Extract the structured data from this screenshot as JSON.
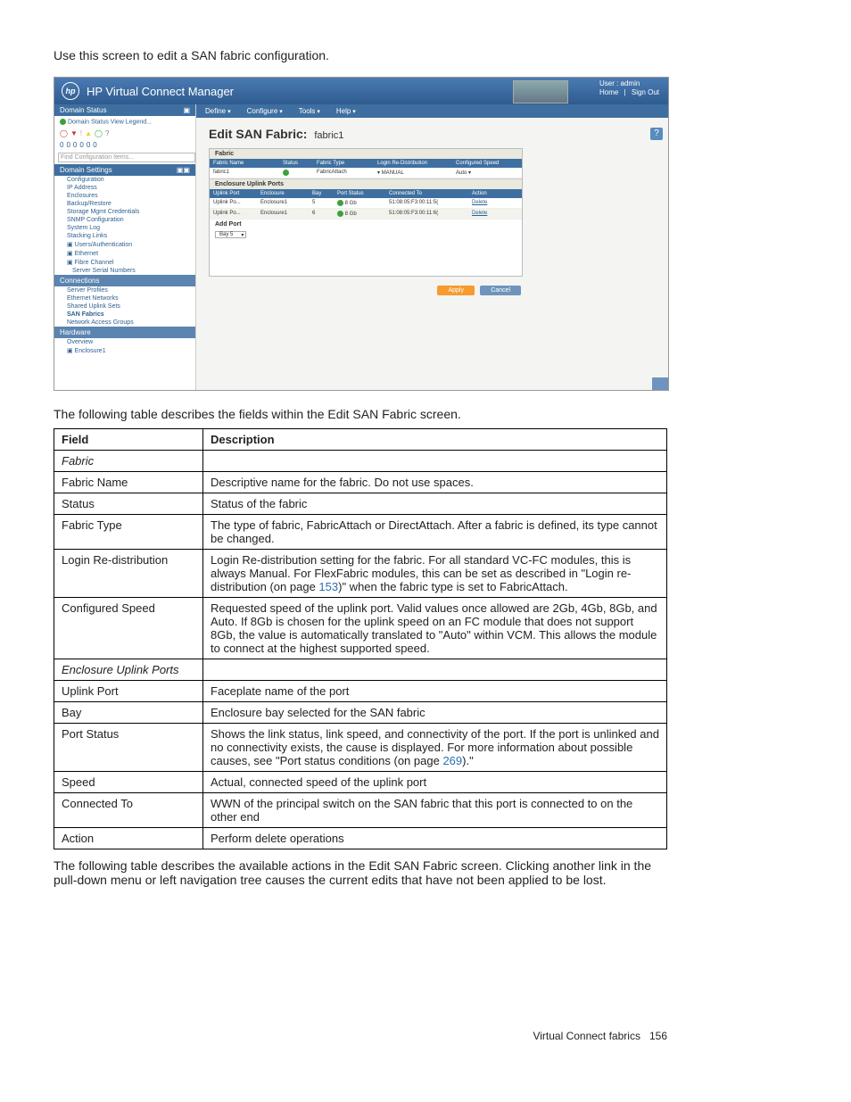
{
  "intro": "Use this screen to edit a SAN fabric configuration.",
  "shot": {
    "header_title": "HP Virtual Connect Manager",
    "logo": "hp",
    "user_line1": "User : admin",
    "home": "Home",
    "signout": "Sign Out",
    "menus": [
      "Define",
      "Configure",
      "Tools",
      "Help"
    ],
    "sidebar": {
      "status_head": "Domain Status",
      "status_sub": "Domain Status   View Legend...",
      "icons_row1": [
        "●",
        "▼",
        "!",
        "⚠",
        "○",
        "?"
      ],
      "icons_row2": [
        "0",
        "0",
        "0",
        "0",
        "0",
        "0"
      ],
      "find_placeholder": "Find Configuration Items...",
      "settings_head": "Domain Settings",
      "items": [
        "Configuration",
        "IP Address",
        "Enclosures",
        "Backup/Restore",
        "Storage Mgmt Credentials",
        "SNMP Configuration",
        "System Log",
        "Stacking Links"
      ],
      "auth_head": "Users/Authentication",
      "eth_head": "Ethernet",
      "fc_head": "Fibre Channel",
      "serial": "Server Serial Numbers",
      "conn_head": "Connections",
      "conn_items": [
        "Server Profiles",
        "Ethernet Networks",
        "Shared Uplink Sets",
        "SAN Fabrics",
        "Network Access Groups"
      ],
      "hw_head": "Hardware",
      "hw_items": [
        "Overview",
        "Enclosure1"
      ]
    },
    "content": {
      "title": "Edit SAN Fabric:",
      "title_sub": "fabric1",
      "panel_title": "Fabric",
      "cols": [
        "Fabric Name",
        "Status",
        "Fabric Type",
        "Login Re-Distribution",
        "Configured Speed"
      ],
      "row": {
        "name": "fabric1",
        "type": "FabricAttach",
        "login": "MANUAL",
        "speed": "Auto"
      },
      "uplinks_title": "Enclosure Uplink Ports",
      "uplinks_cols": [
        "Uplink Port",
        "Enclosure",
        "Bay",
        "Port Status",
        "Connected To",
        "Action"
      ],
      "uplinks_rows": [
        {
          "port": "Uplink Po...",
          "enc": "Enclosure1",
          "bay": "5",
          "speed": "8 Gb",
          "conn": "51:08:05:F3:00:11:5(",
          "action": "Delete"
        },
        {
          "port": "Uplink Po...",
          "enc": "Enclosure1",
          "bay": "6",
          "speed": "8 Gb",
          "conn": "51:08:05:F3:00:11:6(",
          "action": "Delete"
        }
      ],
      "addport_label": "Add Port",
      "addport_value": "Bay 5",
      "apply": "Apply",
      "cancel": "Cancel"
    }
  },
  "desc1": "The following table describes the fields within the Edit SAN Fabric screen.",
  "table1": {
    "headers": [
      "Field",
      "Description"
    ],
    "rows": [
      {
        "f": "Fabric",
        "d": "",
        "italic": true
      },
      {
        "f": "Fabric Name",
        "d": "Descriptive name for the fabric. Do not use spaces."
      },
      {
        "f": "Status",
        "d": "Status of the fabric"
      },
      {
        "f": "Fabric Type",
        "d": "The type of fabric, FabricAttach or DirectAttach. After a fabric is defined, its type cannot be changed."
      },
      {
        "f": "Login Re-distribution",
        "d_pre": "Login Re-distribution setting for the fabric. For all standard VC-FC modules, this is always Manual. For FlexFabric modules, this can be set as described in \"Login re-distribution (on page ",
        "link": "153",
        "d_post": ")\" when the fabric type is set to FabricAttach."
      },
      {
        "f": "Configured Speed",
        "d": "Requested speed of the uplink port. Valid values once allowed are 2Gb, 4Gb, 8Gb, and Auto. If 8Gb is chosen for the uplink speed on an FC module that does not support 8Gb, the value is automatically translated to \"Auto\" within VCM. This allows the module to connect at the highest supported speed."
      },
      {
        "f": "Enclosure Uplink Ports",
        "d": "",
        "italic": true
      },
      {
        "f": "Uplink Port",
        "d": "Faceplate name of the port"
      },
      {
        "f": "Bay",
        "d": "Enclosure bay selected for the SAN fabric"
      },
      {
        "f": "Port Status",
        "d_pre": "Shows the link status, link speed, and connectivity of the port. If the port is unlinked and no connectivity exists, the cause is displayed. For more information about possible causes, see \"Port status conditions (on page ",
        "link": "269",
        "d_post": ").\""
      },
      {
        "f": "Speed",
        "d": "Actual, connected speed of the uplink port"
      },
      {
        "f": "Connected To",
        "d": "WWN of the principal switch on the SAN fabric that this port is connected to on the other end"
      },
      {
        "f": "Action",
        "d": "Perform delete operations"
      }
    ]
  },
  "after": "The following table describes the available actions in the Edit SAN Fabric screen. Clicking another link in the pull-down menu or left navigation tree causes the current edits that have not been applied to be lost.",
  "footer": {
    "text": "Virtual Connect fabrics",
    "page": "156"
  }
}
